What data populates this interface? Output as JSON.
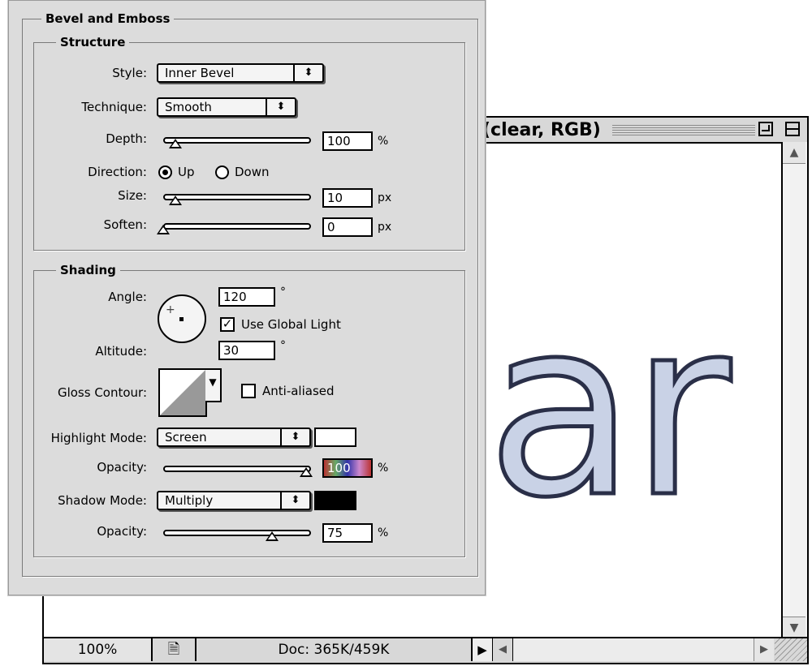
{
  "document_window": {
    "title": "(clear, RGB)",
    "canvas_text": "ar",
    "status": {
      "zoom": "100%",
      "doc_info": "Doc: 365K/459K"
    }
  },
  "dialog": {
    "section_title": "Bevel and Emboss",
    "structure": {
      "title": "Structure",
      "style_label": "Style:",
      "style_value": "Inner Bevel",
      "technique_label": "Technique:",
      "technique_value": "Smooth",
      "depth_label": "Depth:",
      "depth_value": "100",
      "depth_unit": "%",
      "depth_slider": 0.2,
      "direction_label": "Direction:",
      "direction_up": "Up",
      "direction_down": "Down",
      "direction_selected": "Up",
      "size_label": "Size:",
      "size_value": "10",
      "size_unit": "px",
      "size_slider": 0.08,
      "soften_label": "Soften:",
      "soften_value": "0",
      "soften_unit": "px",
      "soften_slider": 0
    },
    "shading": {
      "title": "Shading",
      "angle_label": "Angle:",
      "angle_value": "120",
      "angle_unit": "°",
      "global_light_label": "Use Global Light",
      "global_light_checked": true,
      "altitude_label": "Altitude:",
      "altitude_value": "30",
      "altitude_unit": "°",
      "gloss_contour_label": "Gloss Contour:",
      "anti_aliased_label": "Anti-aliased",
      "anti_aliased_checked": false,
      "highlight_mode_label": "Highlight Mode:",
      "highlight_mode_value": "Screen",
      "highlight_color": "#ffffff",
      "highlight_opacity_label": "Opacity:",
      "highlight_opacity_value": "100",
      "highlight_opacity_unit": "%",
      "shadow_mode_label": "Shadow Mode:",
      "shadow_mode_value": "Multiply",
      "shadow_color": "#000000",
      "shadow_opacity_label": "Opacity:",
      "shadow_opacity_value": "75",
      "shadow_opacity_unit": "%"
    }
  }
}
